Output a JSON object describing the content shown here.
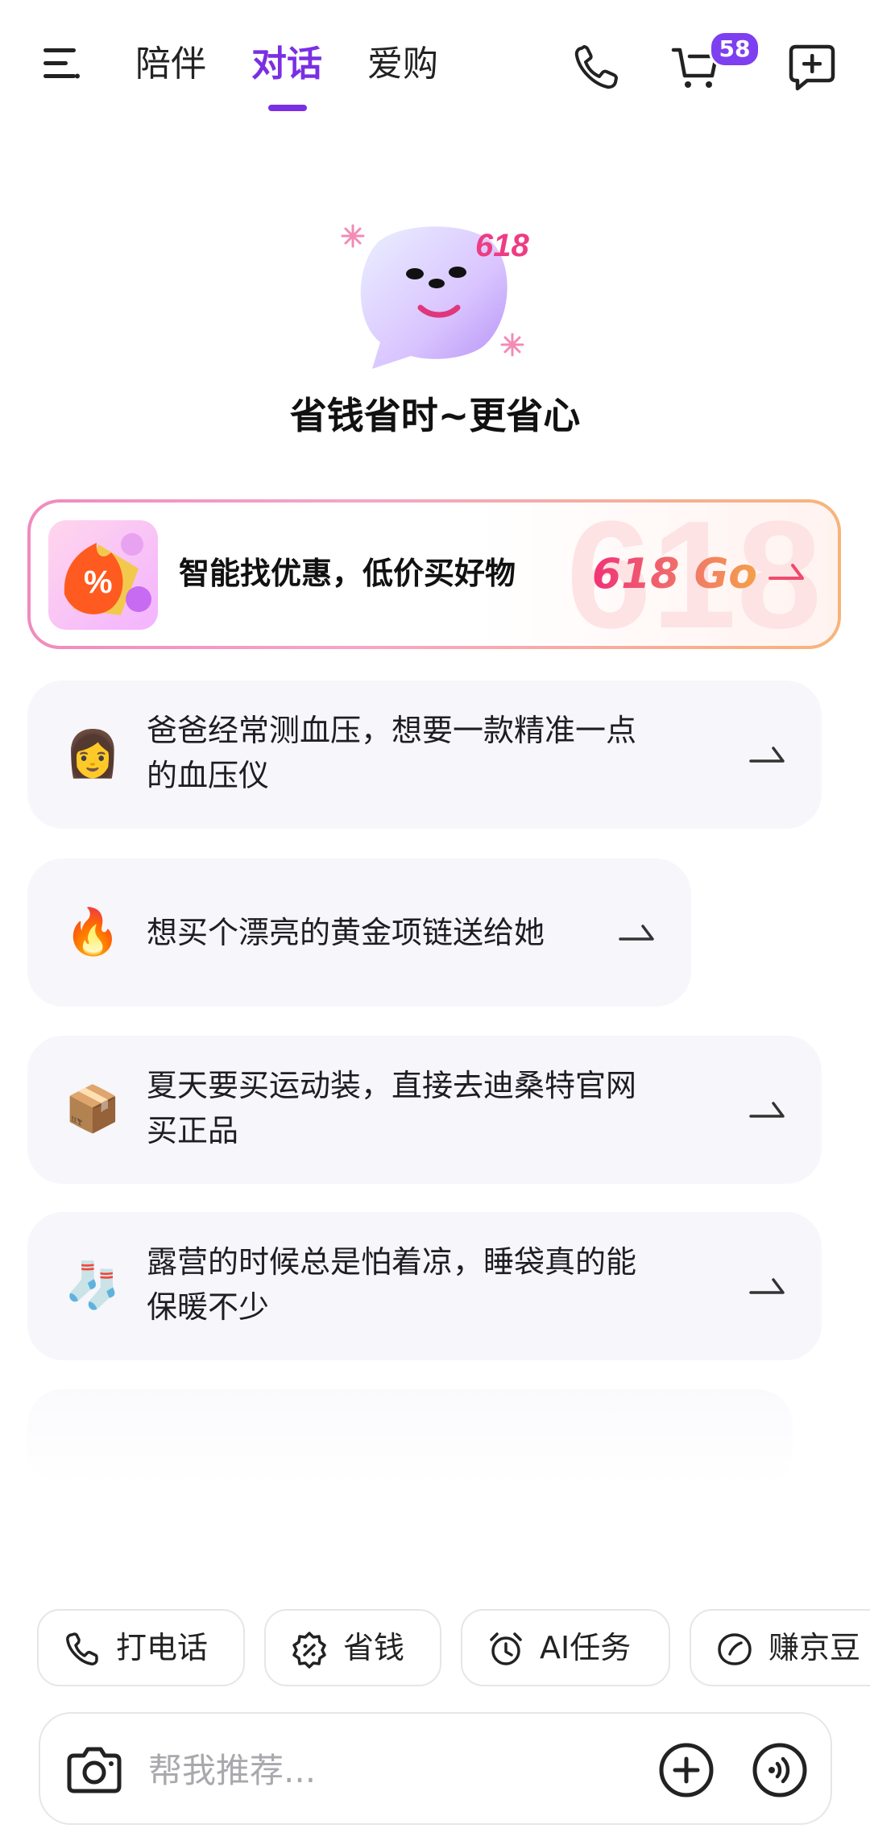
{
  "header": {
    "tabs": [
      {
        "label": "陪伴"
      },
      {
        "label": "对话"
      },
      {
        "label": "爱购"
      }
    ],
    "active_tab": "对话",
    "cart_badge": "58"
  },
  "hero": {
    "mascot_badge": "618",
    "slogan": "省钱省时~更省心"
  },
  "promo": {
    "text": "智能找优惠，低价买好物",
    "tag": "618 Go",
    "icon_symbol": "%",
    "ghost_text": "618"
  },
  "suggestions": [
    {
      "emoji": "👩",
      "line1": " 爸爸经常测血压，想要一款精准一点",
      "line2": "的血压仪"
    },
    {
      "emoji": "🔥",
      "line1": "想买个漂亮的黄金项链送给她",
      "line2": ""
    },
    {
      "emoji": "📦",
      "line1": "夏天要买运动装，直接去迪桑特官网",
      "line2": "买正品"
    },
    {
      "emoji": "🧦",
      "line1": "露营的时候总是怕着凉，睡袋真的能",
      "line2": "保暖不少"
    }
  ],
  "quick_actions": [
    {
      "label": "打电话",
      "icon": "phone-icon"
    },
    {
      "label": "省钱",
      "icon": "coupon-icon"
    },
    {
      "label": "AI任务",
      "icon": "alarm-icon"
    },
    {
      "label": "赚京豆",
      "icon": "bean-icon"
    }
  ],
  "input": {
    "placeholder": "帮我推荐..."
  },
  "colors": {
    "accent": "#7b2fe3",
    "badge": "#7e3ff0",
    "card_bg": "#f7f6fb"
  }
}
